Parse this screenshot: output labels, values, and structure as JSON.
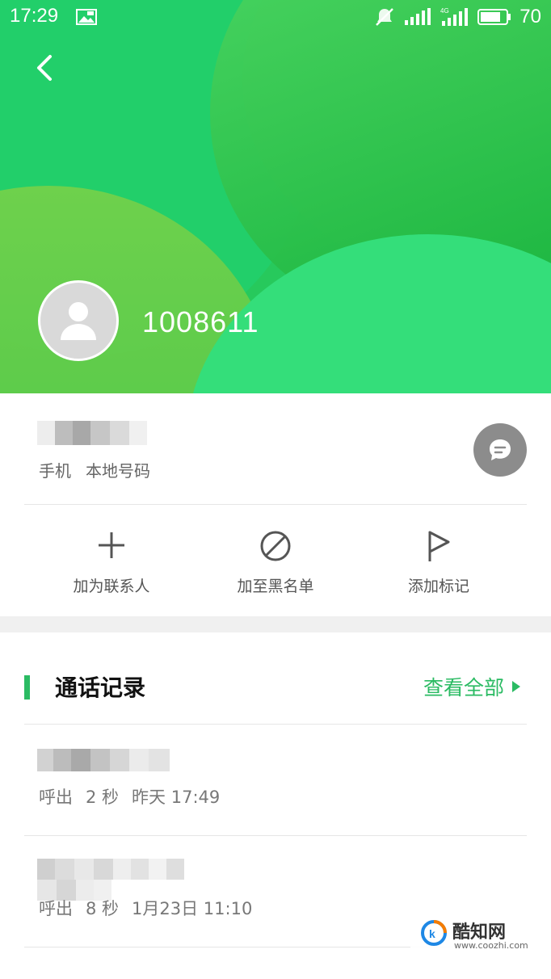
{
  "status_bar": {
    "time": "17:29",
    "battery": "70"
  },
  "contact": {
    "number": "1008611"
  },
  "phone_entry": {
    "type": "手机",
    "location": "本地号码"
  },
  "actions": [
    {
      "label": "加为联系人",
      "icon": "plus-icon"
    },
    {
      "label": "加至黑名单",
      "icon": "block-icon"
    },
    {
      "label": "添加标记",
      "icon": "flag-icon"
    }
  ],
  "call_log": {
    "title": "通话记录",
    "view_all": "查看全部",
    "items": [
      {
        "direction": "呼出",
        "duration": "2 秒",
        "time": "昨天 17:49"
      },
      {
        "direction": "呼出",
        "duration": "8 秒",
        "time": "1月23日 11:10"
      }
    ]
  },
  "watermark": {
    "name": "酷知网",
    "url": "www.coozhi.com"
  },
  "colors": {
    "accent": "#2bbb63",
    "header_green": "#27c95c"
  }
}
